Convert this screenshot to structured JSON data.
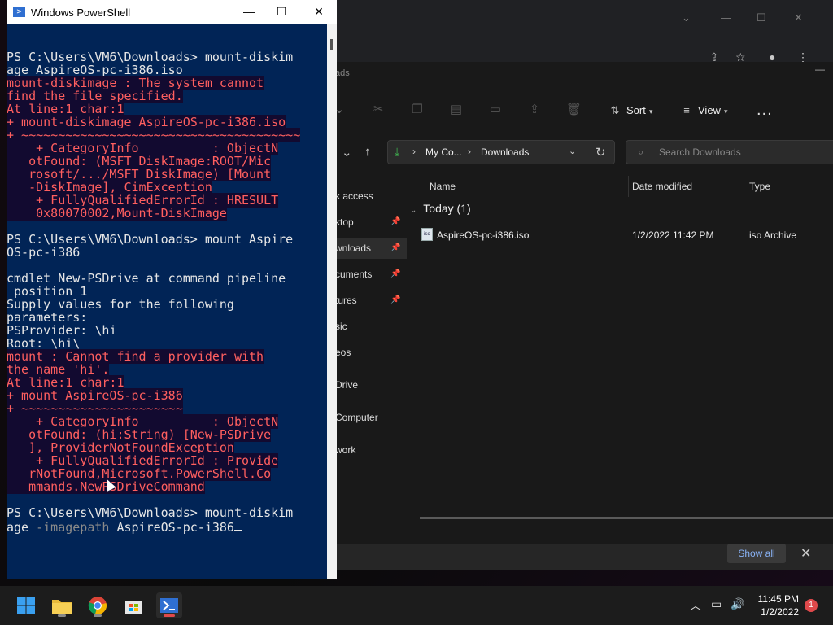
{
  "powershell": {
    "title": "Windows PowerShell",
    "lines": [
      {
        "text": "PS C:\\Users\\VM6\\Downloads> mount-diskim",
        "type": "normal"
      },
      {
        "text": "age AspireOS-pc-i386.iso",
        "type": "normal"
      },
      {
        "text": "mount-diskimage : The system cannot",
        "type": "error"
      },
      {
        "text": "find the file specified.",
        "type": "error"
      },
      {
        "text": "At line:1 char:1",
        "type": "error"
      },
      {
        "text": "+ mount-diskimage AspireOS-pc-i386.iso",
        "type": "error"
      },
      {
        "text": "+ ~~~~~~~~~~~~~~~~~~~~~~~~~~~~~~~~~~~~~~",
        "type": "error"
      },
      {
        "text": "    + CategoryInfo          : ObjectN",
        "type": "error"
      },
      {
        "text": "   otFound: (MSFT_DiskImage:ROOT/Mic",
        "type": "error"
      },
      {
        "text": "   rosoft/.../MSFT_DiskImage) [Mount",
        "type": "error"
      },
      {
        "text": "   -DiskImage], CimException",
        "type": "error"
      },
      {
        "text": "    + FullyQualifiedErrorId : HRESULT",
        "type": "error"
      },
      {
        "text": "    0x80070002,Mount-DiskImage",
        "type": "error"
      },
      {
        "text": "",
        "type": "normal"
      },
      {
        "text": "PS C:\\Users\\VM6\\Downloads> mount Aspire",
        "type": "normal"
      },
      {
        "text": "OS-pc-i386",
        "type": "normal"
      },
      {
        "text": "",
        "type": "normal"
      },
      {
        "text": "cmdlet New-PSDrive at command pipeline",
        "type": "normal"
      },
      {
        "text": " position 1",
        "type": "normal"
      },
      {
        "text": "Supply values for the following",
        "type": "normal"
      },
      {
        "text": "parameters:",
        "type": "normal"
      },
      {
        "text": "PSProvider: \\hi",
        "type": "normal"
      },
      {
        "text": "Root: \\hi\\",
        "type": "normal"
      },
      {
        "text": "mount : Cannot find a provider with",
        "type": "error"
      },
      {
        "text": "the name 'hi'.",
        "type": "error"
      },
      {
        "text": "At line:1 char:1",
        "type": "error"
      },
      {
        "text": "+ mount AspireOS-pc-i386",
        "type": "error"
      },
      {
        "text": "+ ~~~~~~~~~~~~~~~~~~~~~~",
        "type": "error"
      },
      {
        "text": "    + CategoryInfo          : ObjectN",
        "type": "error"
      },
      {
        "text": "   otFound: (hi:String) [New-PSDrive",
        "type": "error"
      },
      {
        "text": "   ], ProviderNotFoundException",
        "type": "error"
      },
      {
        "text": "    + FullyQualifiedErrorId : Provide",
        "type": "error"
      },
      {
        "text": "   rNotFound,Microsoft.PowerShell.Co",
        "type": "error"
      },
      {
        "text": "   mmands.NewPSDriveCommand",
        "type": "error"
      },
      {
        "text": "",
        "type": "normal"
      },
      {
        "text": "PS C:\\Users\\VM6\\Downloads> mount-diskim",
        "type": "normal"
      }
    ],
    "last_line_prefix": "age ",
    "last_line_param": "-imagepath",
    "last_line_value": " AspireOS-pc-i386"
  },
  "explorer": {
    "window_title": "ads",
    "toolbar": {
      "sort_label": "Sort",
      "view_label": "View",
      "more_label": "..."
    },
    "address": {
      "crumb1": "My Co...",
      "crumb2": "Downloads"
    },
    "search_placeholder": "Search Downloads",
    "sidebar": [
      {
        "label": "k access",
        "pinned": false
      },
      {
        "label": "ktop",
        "pinned": true
      },
      {
        "label": "wnloads",
        "pinned": true
      },
      {
        "label": "cuments",
        "pinned": true
      },
      {
        "label": "tures",
        "pinned": true
      },
      {
        "label": "sic",
        "pinned": false
      },
      {
        "label": "eos",
        "pinned": false
      },
      {
        "label": "Drive",
        "pinned": false
      },
      {
        "label": "Computer",
        "pinned": false
      },
      {
        "label": "work",
        "pinned": false
      }
    ],
    "columns": {
      "name": "Name",
      "date": "Date modified",
      "type": "Type"
    },
    "group": "Today (1)",
    "files": [
      {
        "name": "AspireOS-pc-i386.iso",
        "date": "1/2/2022 11:42 PM",
        "type": "iso Archive",
        "icon": "iso-file-icon"
      }
    ],
    "notification": {
      "show_all": "Show all"
    }
  },
  "taskbar": {
    "time": "11:45 PM",
    "date": "1/2/2022",
    "notification_count": "1"
  }
}
